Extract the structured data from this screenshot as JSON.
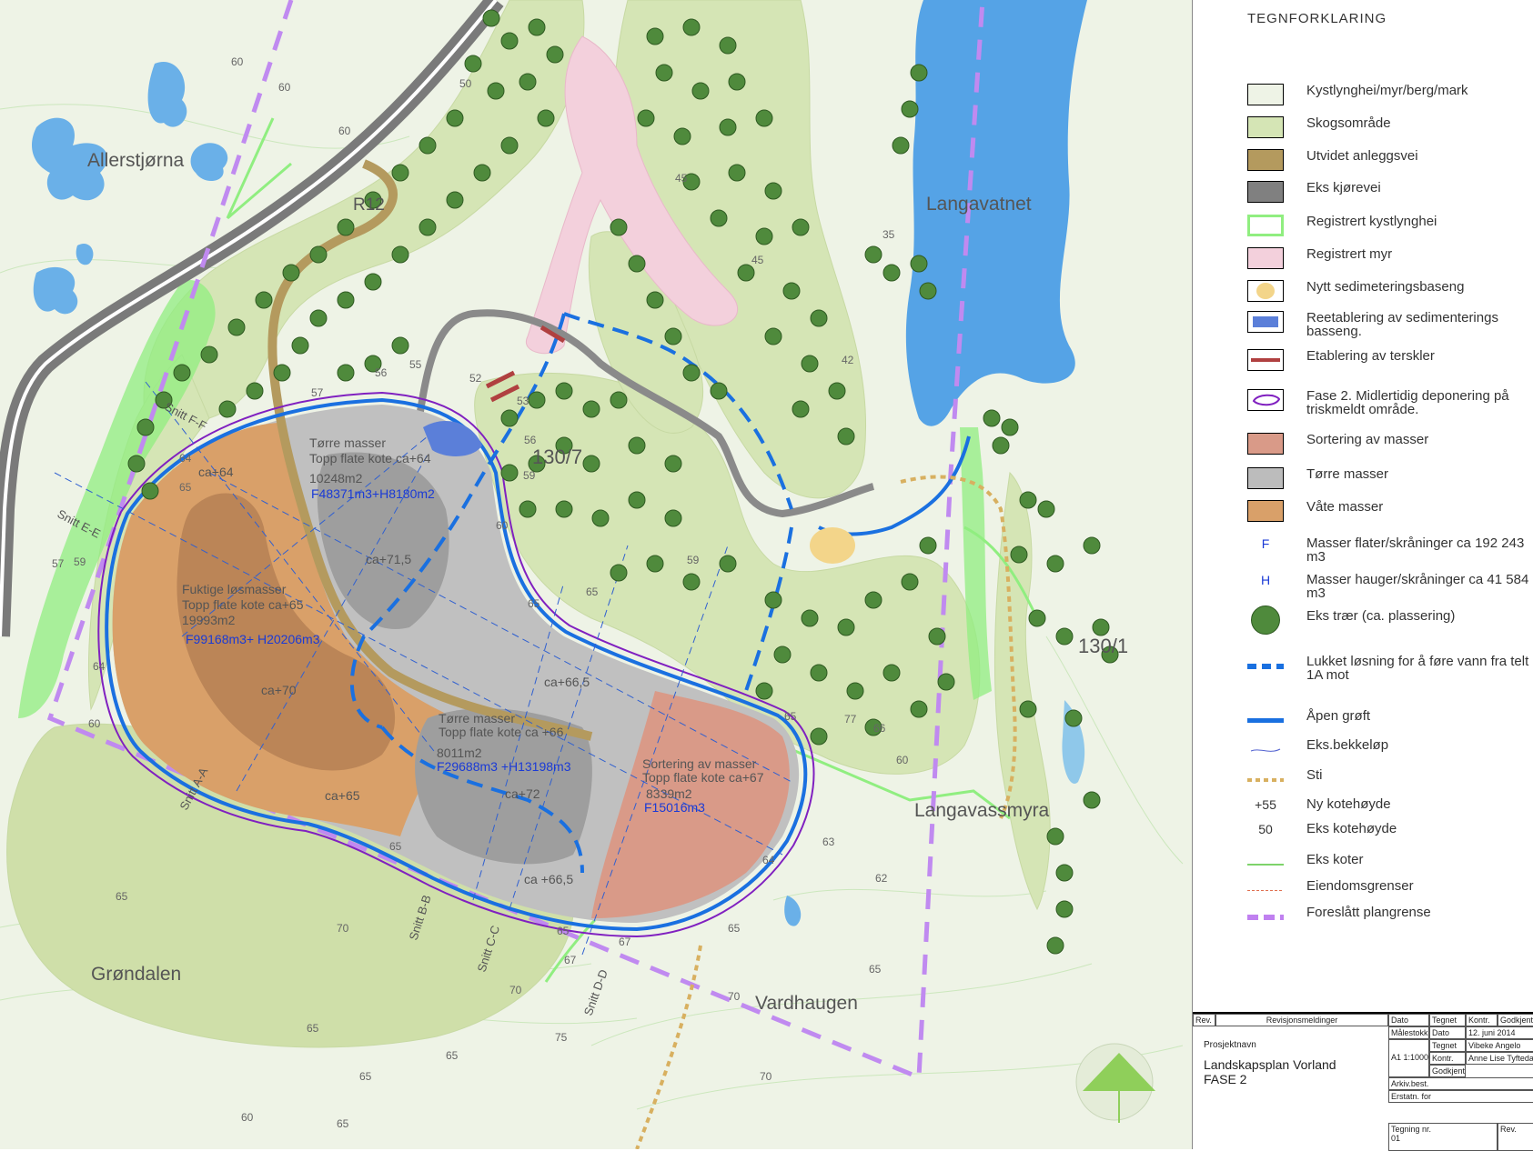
{
  "legend": {
    "title": "TEGNFORKLARING",
    "items": [
      {
        "label": "Kystlynghei/myr/berg/mark",
        "color": "#eef3e6"
      },
      {
        "label": "Skogsområde",
        "color": "#d5e5b5"
      },
      {
        "label": "Utvidet anleggsvei",
        "color": "#b49a5e"
      },
      {
        "label": "Eks kjørevei",
        "color": "#808080"
      },
      {
        "label": "Registrert kystlynghei",
        "color": "#90ee80"
      },
      {
        "label": "Registrert myr",
        "color": "#f3d0dc"
      },
      {
        "label": "Nytt sedimeteringsbaseng",
        "color": "#f3d58a"
      },
      {
        "label": "Reetablering av sedimenterings basseng.",
        "color": "#5b7fd9"
      },
      {
        "label": "Etablering av terskler",
        "color": "#b04040"
      },
      {
        "label": "Fase 2. Midlertidig deponering på triskmeldt område.",
        "color": "#8020c0"
      },
      {
        "label": "Sortering av masser",
        "color": "#d99a88"
      },
      {
        "label": "Tørre masser",
        "color": "#bcbcbc"
      },
      {
        "label": "Våte masser",
        "color": "#d9a069"
      },
      {
        "symbol": "F",
        "label": "Masser flater/skråninger ca 192 243 m3"
      },
      {
        "symbol": "H",
        "label": "Masser hauger/skråninger ca 41 584 m3"
      },
      {
        "label": "Eks trær (ca. plassering)",
        "color": "#4f8a3c"
      },
      {
        "label": "Lukket løsning for å føre vann fra telt 1A mot",
        "color": "#1a70e0"
      },
      {
        "label": "Åpen grøft",
        "color": "#1a70e0"
      },
      {
        "label": "Eks.bekkeløp",
        "color": "#5060d0"
      },
      {
        "label": "Sti",
        "color": "#d8b060"
      },
      {
        "symbol": "+55",
        "label": "Ny kotehøyde"
      },
      {
        "symbol": "50",
        "label": "Eks kotehøyde"
      },
      {
        "label": "Eks koter",
        "color": "#7ed36a"
      },
      {
        "label": "Eiendomsgrenser",
        "color": "#e07050"
      },
      {
        "label": "Foreslått plangrense",
        "color": "#c080f0"
      }
    ]
  },
  "titleblock": {
    "rev": "Rev.",
    "revision_text": "Revisjonsmeldinger",
    "date_label": "Dato",
    "drawn_label": "Tegnet",
    "check_label": "Kontr.",
    "approved_label": "Godkjent",
    "project_label": "Prosjektnavn",
    "project_name": "Landskapsplan Vorland",
    "phase": "FASE 2",
    "scale_label": "Målestokk",
    "scale": "A1 1:1000",
    "date_value": "12. juni 2014",
    "drawn_value": "Vibeke Angelo",
    "check_value": "Anne Lise Tyftedal",
    "arch_label": "Arkiv.best.",
    "replaced_label": "Erstatn. for",
    "drawing_no_label": "Tegning nr.",
    "drawing_no": "01",
    "rev_no_label": "Rev."
  },
  "map": {
    "places": {
      "allerstjorna": "Allerstjørna",
      "langavatnet": "Langavatnet",
      "langavassmyra": "Langavassmyra",
      "grondalen": "Grøndalen",
      "vardhaugen": "Vardhaugen",
      "road": "R12",
      "plot_130_7": "130/7",
      "plot_130_1": "130/1"
    },
    "areas": {
      "dry1_title": "Tørre masser",
      "dry1_level": "Topp flate kote ca+64",
      "dry1_area": "10248m2",
      "dry1_volume": "F48371m3+H8180m2",
      "dry1_peak": "ca+71,5",
      "wet_title": "Fuktige løsmasser",
      "wet_level": "Topp flate kote ca+65",
      "wet_area": "19993m2",
      "wet_volume": "F99168m3+ H20206m3",
      "wet_peak": "ca+70",
      "dry2_title": "Tørre masser",
      "dry2_level": "Topp flate kote ca +66",
      "dry2_area": "8011m2",
      "dry2_volume": "F29688m3 +H13198m3",
      "dry2_peak": "ca+72",
      "sort_title": "Sortering av masser",
      "sort_level": "Topp flate kote ca+67",
      "sort_area": "8339m2",
      "sort_volume": "F15016m3",
      "lvl_ca64": "ca+64",
      "lvl_ca65": "ca+65",
      "lvl_ca665a": "ca+66,5",
      "lvl_ca665b": "ca +66,5"
    },
    "sections": {
      "a": "Snitt A-A",
      "b": "Snitt B-B",
      "c": "Snitt C-C",
      "d": "Snitt D-D",
      "e": "Snitt E-E",
      "f": "Snitt F-F"
    },
    "contours": [
      "60",
      "60",
      "60",
      "50",
      "45",
      "45",
      "35",
      "42",
      "55",
      "56",
      "57",
      "53",
      "52",
      "56",
      "59",
      "60",
      "59",
      "65",
      "65",
      "64",
      "65",
      "57",
      "59",
      "64",
      "60",
      "65",
      "70",
      "65",
      "70",
      "65",
      "65",
      "75",
      "60",
      "65",
      "77",
      "60",
      "65",
      "66",
      "62",
      "64",
      "65",
      "65",
      "70",
      "65",
      "65",
      "67",
      "67",
      "70",
      "63"
    ]
  }
}
